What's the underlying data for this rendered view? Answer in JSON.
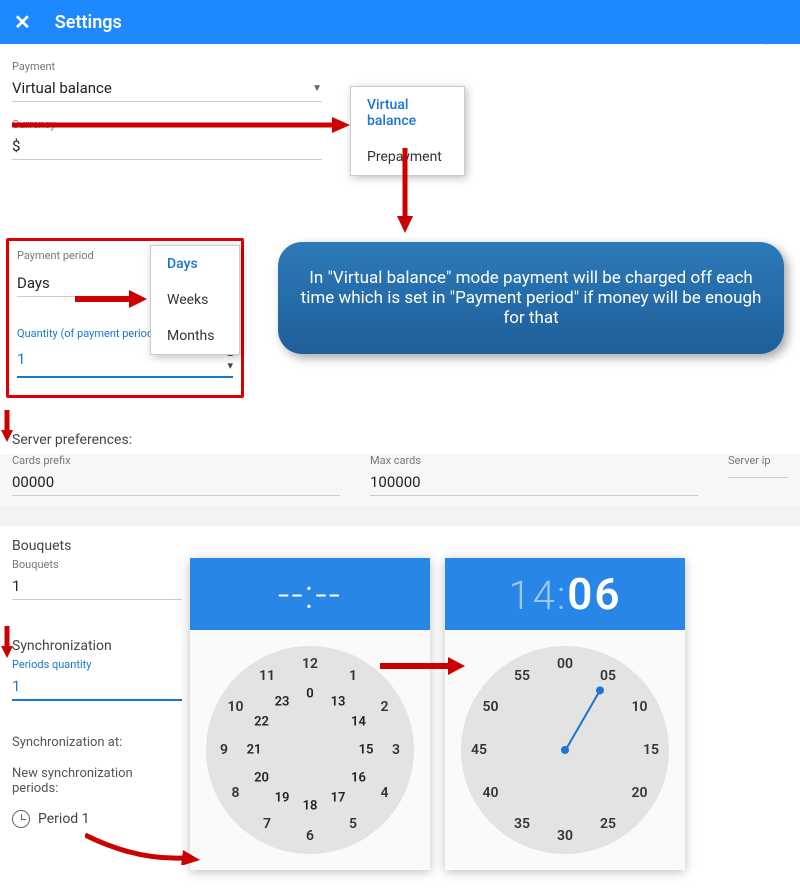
{
  "header": {
    "title": "Settings"
  },
  "payment": {
    "label": "Payment",
    "value": "Virtual balance",
    "options": [
      "Virtual balance",
      "Prepayment"
    ]
  },
  "currency": {
    "label": "Currency",
    "value": "$"
  },
  "period": {
    "label": "Payment period",
    "value": "Days",
    "options": [
      "Days",
      "Weeks",
      "Months"
    ]
  },
  "quantity": {
    "label": "Quantity (of payment period)",
    "value": "1"
  },
  "callout": "In \"Virtual balance\" mode payment will be charged off each time which is set in \"Payment period\" if money will be enough for that",
  "server": {
    "title": "Server preferences:",
    "cards_prefix": {
      "label": "Cards prefix",
      "value": "00000"
    },
    "max_cards": {
      "label": "Max cards",
      "value": "100000"
    },
    "server_ip": {
      "label": "Server ip",
      "value": ""
    }
  },
  "bouquets": {
    "section": "Bouquets",
    "label": "Bouquets",
    "value": "1"
  },
  "sync": {
    "title": "Synchronization",
    "periods_label": "Periods quantity",
    "periods_value": "1",
    "at_label": "Synchronization at:",
    "new_periods_label": "New synchronization periods:",
    "period_item": "Period 1"
  },
  "clock_left": {
    "display": "--:--"
  },
  "clock_right": {
    "hours": "14",
    "minutes": "06"
  },
  "hour_numbers_outer": [
    "12",
    "1",
    "2",
    "3",
    "4",
    "5",
    "6",
    "7",
    "8",
    "9",
    "10",
    "11"
  ],
  "hour_numbers_inner": [
    "0",
    "13",
    "14",
    "15",
    "16",
    "17",
    "18",
    "19",
    "20",
    "21",
    "22",
    "23"
  ],
  "minute_numbers": [
    "00",
    "05",
    "10",
    "15",
    "20",
    "25",
    "30",
    "35",
    "40",
    "45",
    "50",
    "55"
  ]
}
